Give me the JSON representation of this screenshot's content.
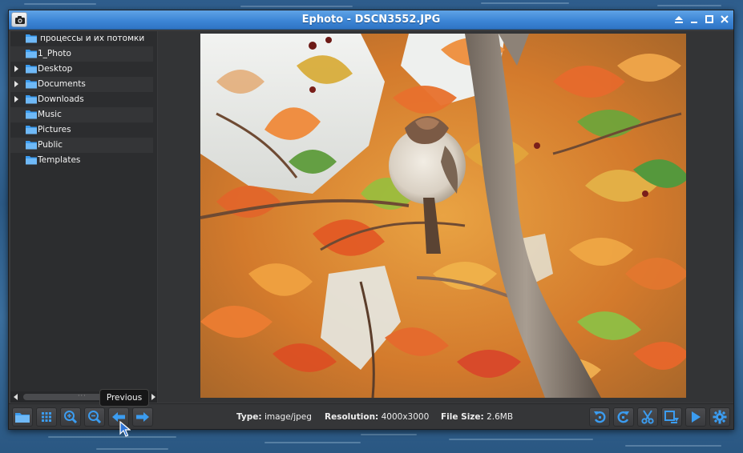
{
  "window": {
    "title": "Ephoto - DSCN3552.JPG"
  },
  "sidebar": {
    "items": [
      {
        "label": "процессы и их потомки",
        "expandable": false
      },
      {
        "label": "1_Photo",
        "expandable": false
      },
      {
        "label": "Desktop",
        "expandable": true
      },
      {
        "label": "Documents",
        "expandable": true
      },
      {
        "label": "Downloads",
        "expandable": true
      },
      {
        "label": "Music",
        "expandable": false
      },
      {
        "label": "Pictures",
        "expandable": false
      },
      {
        "label": "Public",
        "expandable": false
      },
      {
        "label": "Templates",
        "expandable": false
      }
    ]
  },
  "toolbar": {
    "tooltip": "Previous",
    "left_buttons": [
      "folder-icon",
      "grid-icon",
      "zoom-in-icon",
      "zoom-out-icon",
      "arrow-left-icon",
      "arrow-right-icon"
    ],
    "right_buttons": [
      "rotate-left-icon",
      "rotate-right-icon",
      "scissors-icon",
      "crop-icon",
      "play-icon",
      "gear-icon"
    ]
  },
  "info": {
    "type_label": "Type:",
    "type_value": "image/jpeg",
    "resolution_label": "Resolution:",
    "resolution_value": "4000x3000",
    "size_label": "File Size:",
    "size_value": "2.6MB"
  },
  "colors": {
    "titlebar": "#3d86d6",
    "accent_icon": "#3b9cf0",
    "window_bg": "#3a3b3d"
  }
}
